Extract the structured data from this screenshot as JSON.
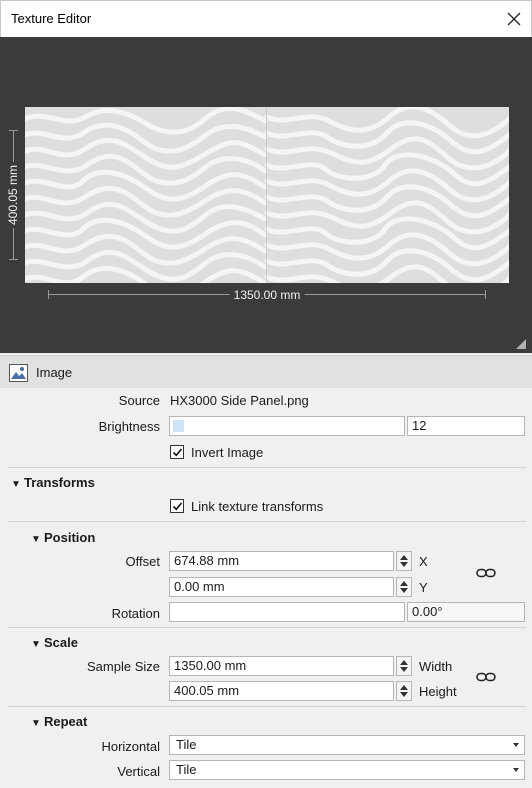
{
  "window": {
    "title": "Texture Editor"
  },
  "preview": {
    "width_label": "1350.00 mm",
    "height_label": "400.05 mm"
  },
  "image_section": {
    "label": "Image"
  },
  "source": {
    "label": "Source",
    "value": "HX3000 Side Panel.png"
  },
  "brightness": {
    "label": "Brightness",
    "value": "12",
    "level_fraction": 0.05
  },
  "invert_image": {
    "label": "Invert Image",
    "checked": true
  },
  "transforms": {
    "label": "Transforms",
    "link_label": "Link texture transforms",
    "link_checked": true
  },
  "position": {
    "label": "Position",
    "offset_label": "Offset",
    "offset_x": "674.88 mm",
    "offset_y": "0.00 mm",
    "x_label": "X",
    "y_label": "Y",
    "rotation_label": "Rotation",
    "rotation_value": "",
    "rotation_readout": "0.00°"
  },
  "scale": {
    "label": "Scale",
    "sample_size_label": "Sample Size",
    "width_value": "1350.00 mm",
    "height_value": "400.05 mm",
    "width_label": "Width",
    "height_label": "Height"
  },
  "repeat": {
    "label": "Repeat",
    "horizontal_label": "Horizontal",
    "horizontal_value": "Tile",
    "vertical_label": "Vertical",
    "vertical_value": "Tile"
  }
}
